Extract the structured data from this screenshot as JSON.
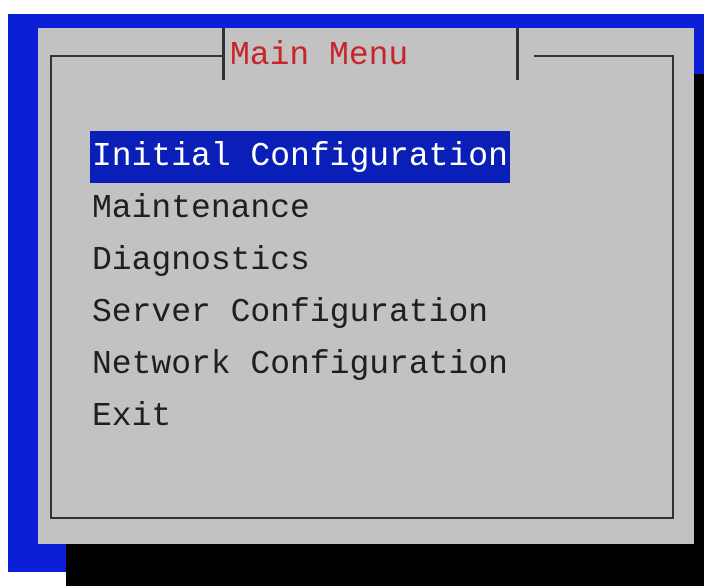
{
  "dialog": {
    "title": "Main Menu"
  },
  "menu": {
    "items": [
      {
        "label": "Initial Configuration",
        "selected": true
      },
      {
        "label": "Maintenance",
        "selected": false
      },
      {
        "label": "Diagnostics",
        "selected": false
      },
      {
        "label": "Server Configuration",
        "selected": false
      },
      {
        "label": "Network Configuration",
        "selected": false
      },
      {
        "label": "Exit",
        "selected": false
      }
    ]
  },
  "colors": {
    "background": "#0a1fd6",
    "dialog": "#c2c2c2",
    "title": "#c8252b",
    "selection": "#0a1fb8",
    "text": "#1f1f1f"
  }
}
